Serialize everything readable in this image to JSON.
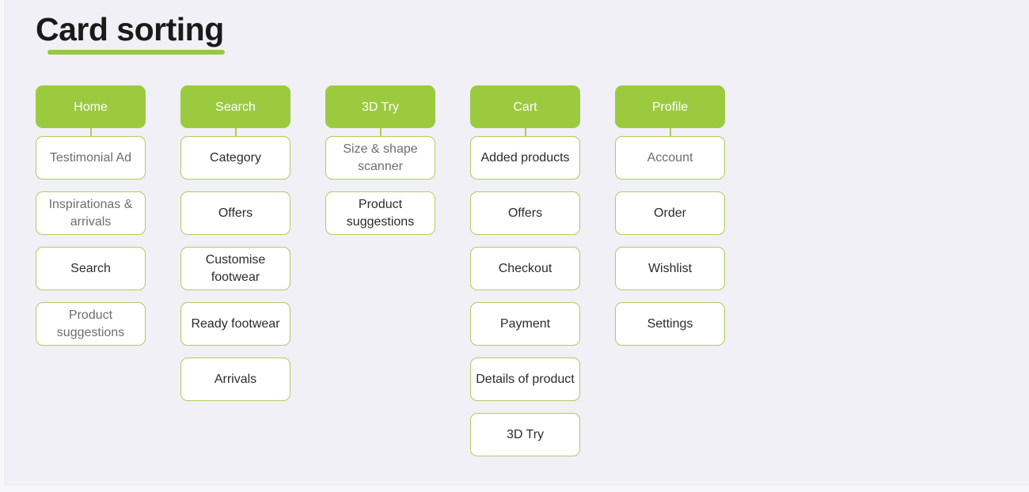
{
  "page": {
    "title": "Card sorting",
    "background_color": "#f1f0f6",
    "accent_color": "#9cca3f",
    "card_border_color": "#aecc5f"
  },
  "columns": [
    {
      "header": "Home",
      "cards": [
        {
          "label": "Testimonial Ad",
          "muted": true
        },
        {
          "label": "Inspirationas & arrivals",
          "muted": true
        },
        {
          "label": "Search",
          "muted": false
        },
        {
          "label": "Product suggestions",
          "muted": true
        }
      ]
    },
    {
      "header": "Search",
      "cards": [
        {
          "label": "Category",
          "muted": false
        },
        {
          "label": "Offers",
          "muted": false
        },
        {
          "label": "Customise footwear",
          "muted": false
        },
        {
          "label": "Ready footwear",
          "muted": false
        },
        {
          "label": "Arrivals",
          "muted": false
        }
      ]
    },
    {
      "header": "3D Try",
      "cards": [
        {
          "label": "Size & shape scanner",
          "muted": true
        },
        {
          "label": "Product suggestions",
          "muted": false
        }
      ]
    },
    {
      "header": "Cart",
      "cards": [
        {
          "label": "Added products",
          "muted": false
        },
        {
          "label": "Offers",
          "muted": false
        },
        {
          "label": "Checkout",
          "muted": false
        },
        {
          "label": "Payment",
          "muted": false
        },
        {
          "label": "Details of product",
          "muted": false
        },
        {
          "label": "3D Try",
          "muted": false
        }
      ]
    },
    {
      "header": "Profile",
      "cards": [
        {
          "label": "Account",
          "muted": true
        },
        {
          "label": "Order",
          "muted": false
        },
        {
          "label": "Wishlist",
          "muted": false
        },
        {
          "label": "Settings",
          "muted": false
        }
      ]
    }
  ]
}
